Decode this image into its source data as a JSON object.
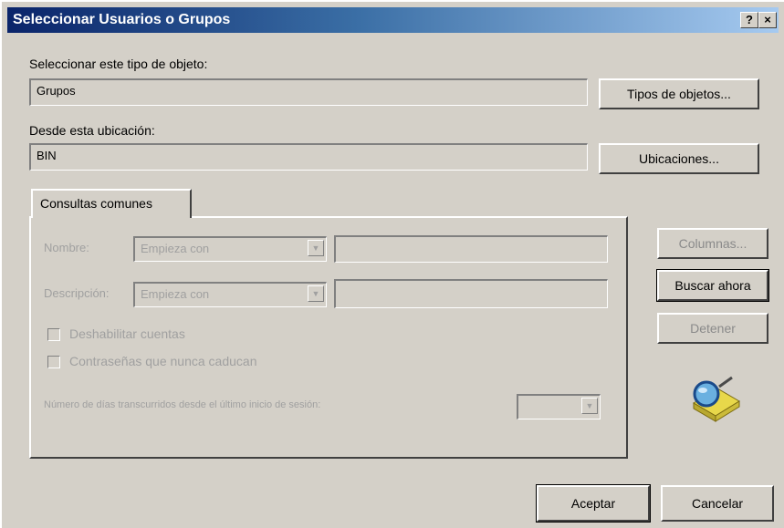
{
  "window": {
    "title": "Seleccionar Usuarios o Grupos",
    "help_label": "?",
    "close_label": "×"
  },
  "object_type": {
    "label": "Seleccionar este tipo de objeto:",
    "value": "Grupos",
    "button": "Tipos de objetos..."
  },
  "location": {
    "label": "Desde esta ubicación:",
    "value": "BIN",
    "button": "Ubicaciones..."
  },
  "tab": {
    "label": "Consultas comunes"
  },
  "query": {
    "name_label": "Nombre:",
    "name_mode": "Empieza con",
    "description_label": "Descripción:",
    "description_mode": "Empieza con",
    "disabled_accounts": "Deshabilitar cuentas",
    "non_expiring_passwords": "Contraseñas que nunca caducan",
    "days_since_logon": "Número de días transcurridos desde el último inicio de sesión:"
  },
  "side_buttons": {
    "columns": "Columnas...",
    "search_now": "Buscar ahora",
    "stop": "Detener"
  },
  "footer": {
    "ok": "Aceptar",
    "cancel": "Cancelar"
  },
  "icons": {
    "search": "search-icon"
  }
}
